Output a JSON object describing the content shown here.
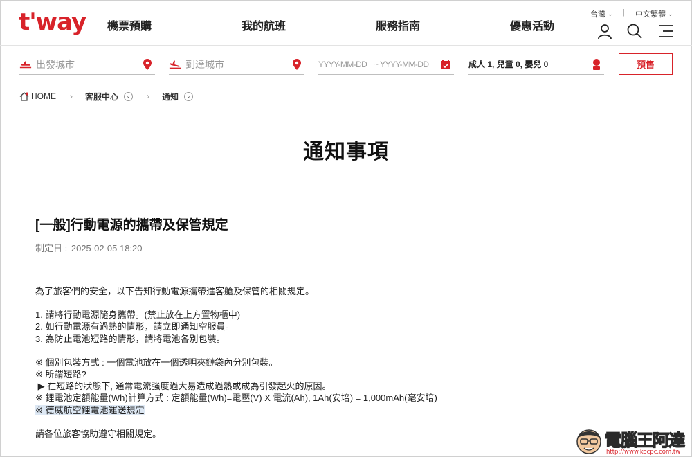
{
  "brand": {
    "logo_text": "t'way",
    "accent": "#d8232a"
  },
  "nav": {
    "items": [
      {
        "label": "機票預購"
      },
      {
        "label": "我的航班"
      },
      {
        "label": "服務指南"
      },
      {
        "label": "優惠活動"
      }
    ],
    "region": "台灣",
    "language": "中文繁體",
    "icons": [
      "user-icon",
      "search-icon",
      "menu-icon"
    ]
  },
  "search": {
    "origin_placeholder": "出發城市",
    "destination_placeholder": "到達城市",
    "date_from_placeholder": "YYYY-MM-DD",
    "date_to_placeholder": "~ YYYY-MM-DD",
    "passengers": "成人 1, 兒童 0, 嬰兒 0",
    "book_label": "預售"
  },
  "breadcrumb": {
    "home": "HOME",
    "level1": "客服中心",
    "level2": "通知"
  },
  "page": {
    "title": "通知事項"
  },
  "notice": {
    "title": "[一般]行動電源的攜帶及保管規定",
    "date_label": "制定日 :",
    "date": "2025-02-05 18:20",
    "intro": "為了旅客們的安全，以下告知行動電源攜帶進客艙及保管的相關規定。",
    "rules": [
      "1. 請將行動電源隨身攜帶。(禁止放在上方置物櫃中)",
      "2. 如行動電源有過熱的情形，請立即通知空服員。",
      "3. 為防止電池短路的情形，請將電池各別包裝。"
    ],
    "notes": [
      "※ 個別包裝方式 : 一個電池放在一個透明夾鏈袋內分別包裝。",
      "※ 所謂短路?",
      " ▶ 在短路的狀態下, 通常電流強度過大易造成過熱或成為引發起火的原因。",
      "※ 鋰電池定額能量(Wh)計算方式 : 定額能量(Wh)=電壓(V) X 電流(Ah), 1Ah(安培) = 1,000mAh(毫安培)"
    ],
    "link": "※ 德威航空鋰電池運送規定",
    "closing": "請各位旅客協助遵守相關規定。"
  },
  "watermark": {
    "text": "電腦王阿達",
    "url": "http://www.kocpc.com.tw"
  }
}
